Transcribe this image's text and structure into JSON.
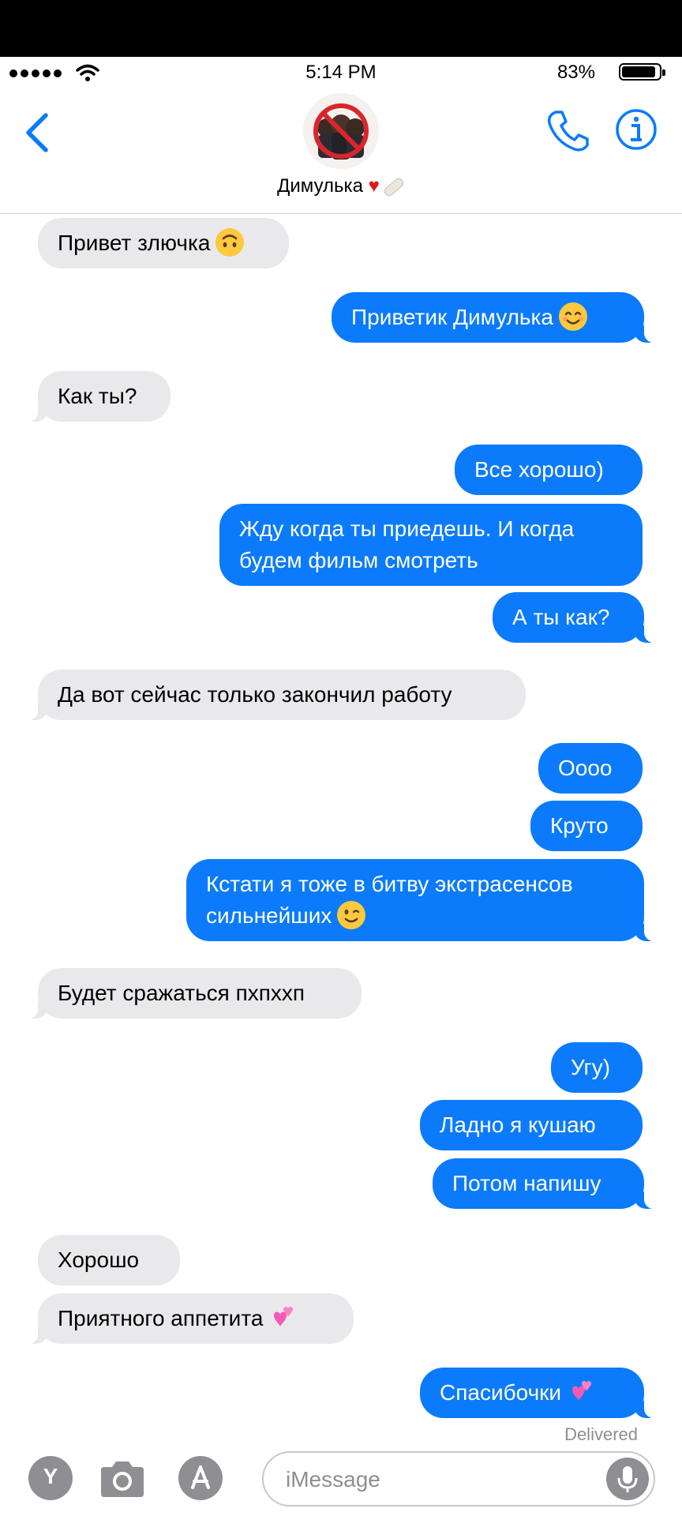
{
  "status_bar": {
    "time": "5:14 PM",
    "battery_percent": "83%",
    "battery_level": 0.83,
    "signal_bars": 5
  },
  "header": {
    "contact_name": "Димулька",
    "contact_emoji": [
      "red-heart",
      "bandage"
    ],
    "back_icon": "chevron-left-icon",
    "call_icon": "phone-icon",
    "info_icon": "info-icon",
    "accent_color": "#0b7bfc"
  },
  "messages": [
    {
      "from": "contact",
      "text": "Привет злючка",
      "emoji": "upside-down-face"
    },
    {
      "from": "me",
      "text": "Приветик Димулька",
      "emoji": "smiling-face"
    },
    {
      "from": "contact",
      "text": "Как ты?"
    },
    {
      "from": "me",
      "text": "Все хорошо)"
    },
    {
      "from": "me",
      "lines": [
        "Жду когда ты приедешь. И когда",
        "будем фильм смотреть"
      ]
    },
    {
      "from": "me",
      "text": "А ты как?"
    },
    {
      "from": "contact",
      "text": "Да вот сейчас только закончил работу"
    },
    {
      "from": "me",
      "text": "Оооо"
    },
    {
      "from": "me",
      "text": "Круто"
    },
    {
      "from": "me",
      "lines": [
        "Кстати я тоже в битву экстрасенсов",
        "сильнейших"
      ],
      "emoji": "winking-face"
    },
    {
      "from": "contact",
      "text": "Будет сражаться пхпххп"
    },
    {
      "from": "me",
      "text": "Угу)"
    },
    {
      "from": "me",
      "text": "Ладно я кушаю"
    },
    {
      "from": "me",
      "text": "Потом напишу"
    },
    {
      "from": "contact",
      "text": "Хорошо"
    },
    {
      "from": "contact",
      "text": "Приятного аппетита",
      "emoji": "two-hearts"
    },
    {
      "from": "me",
      "text": "Спасибочки",
      "emoji": "two-hearts"
    }
  ],
  "delivered_label": "Delivered",
  "input_bar": {
    "placeholder": "iMessage",
    "memoji_label": "Y",
    "camera_icon": "camera-icon",
    "appstore_icon": "app-store-icon",
    "mic_icon": "microphone-icon"
  },
  "colors": {
    "outgoing_bubble": "#0b7bfc",
    "incoming_bubble": "#e9e9eb",
    "emoji_yellow": "#ffc83d",
    "emoji_pink": "#f25ab4"
  }
}
